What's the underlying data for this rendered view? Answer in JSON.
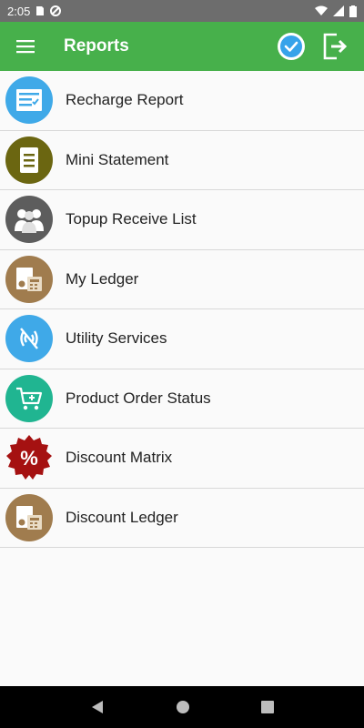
{
  "status_bar": {
    "time": "2:05"
  },
  "app_bar": {
    "title": "Reports"
  },
  "menu_items": [
    {
      "label": "Recharge Report",
      "icon": "report-icon",
      "color": "#3fa9e8"
    },
    {
      "label": "Mini Statement",
      "icon": "statement-icon",
      "color": "#6b6611"
    },
    {
      "label": "Topup Receive List",
      "icon": "users-icon",
      "color": "#5d5d5d"
    },
    {
      "label": "My Ledger",
      "icon": "ledger-icon",
      "color": "#a07c4e"
    },
    {
      "label": "Utility Services",
      "icon": "wireless-icon",
      "color": "#3fa9e8"
    },
    {
      "label": "Product Order Status",
      "icon": "cart-icon",
      "color": "#20b591"
    },
    {
      "label": "Discount Matrix",
      "icon": "discount-icon",
      "color": "#a51111"
    },
    {
      "label": "Discount Ledger",
      "icon": "ledger-icon",
      "color": "#a07c4e"
    }
  ],
  "colors": {
    "app_bar": "#47b04b",
    "status_bar": "#6d6d6d"
  }
}
